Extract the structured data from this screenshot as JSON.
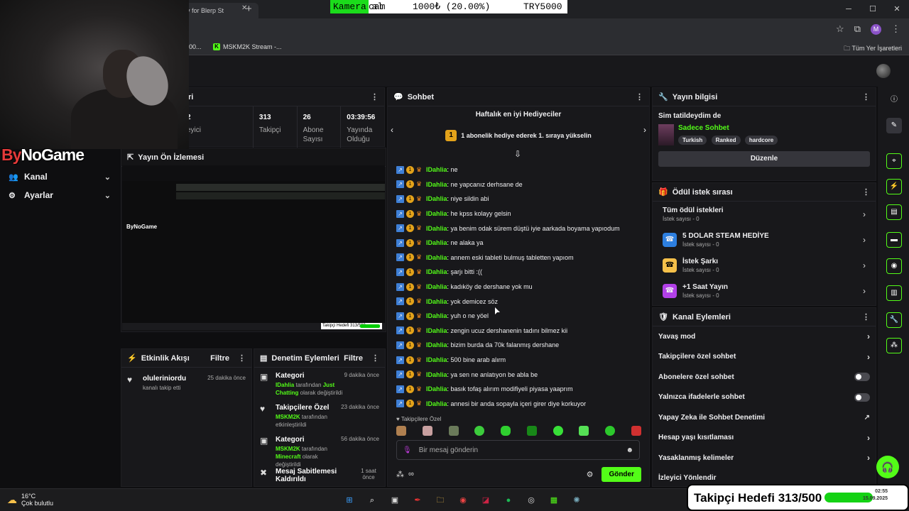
{
  "browser": {
    "tab_title": "ry for Blerp St",
    "bookmark_1": "00...",
    "bookmark_2": "MSKM2K Stream -...",
    "bookmarks_all": "Tüm Yer İşaretleri",
    "profile_letter": "M"
  },
  "ticker": {
    "camera": "Kamera al",
    "cam": "cam",
    "amount": "1000₺ (20.00%)",
    "total": "TRY5000"
  },
  "overlay": {
    "logo_by": "By",
    "logo_rest": "NoGame"
  },
  "sidebar": {
    "items": [
      {
        "label": "Kanal",
        "icon": "people-icon"
      },
      {
        "label": "Ayarlar",
        "icon": "gear-icon"
      }
    ]
  },
  "stats_panel": {
    "title": "ri",
    "stats": [
      {
        "value": "2",
        "label": "eyici"
      },
      {
        "value": "313",
        "label": "Takipçi"
      },
      {
        "value": "26",
        "label": "Abone Sayısı"
      },
      {
        "value": "03:39:56",
        "label": "Yayında Olduğu"
      }
    ]
  },
  "preview": {
    "title": "Yayın Ön İzlemesi",
    "goal": "Takipçi Hedefi 313/500"
  },
  "events": {
    "title": "Etkinlik Akışı",
    "filter": "Filtre",
    "items": [
      {
        "title": "oluleriniordu",
        "sub": "kanalı takip etti",
        "time": "25 dakika önce"
      }
    ]
  },
  "moderation": {
    "title": "Denetim Eylemleri",
    "filter": "Filtre",
    "items": [
      {
        "title": "Kategori",
        "actor": "IDahlia",
        "mid": "tarafından",
        "target": "Just Chatting",
        "end": "olarak değiştirildi",
        "time": "9 dakika önce"
      },
      {
        "title": "Takipçilere Özel",
        "actor": "MSKM2K",
        "mid": "tarafından etkinleştirildi",
        "target": "",
        "end": "",
        "time": "23 dakika önce"
      },
      {
        "title": "Kategori",
        "actor": "MSKM2K",
        "mid": "tarafından",
        "target": "Minecraft",
        "end": "olarak değiştirildi",
        "time": "56 dakika önce"
      },
      {
        "title": "Mesaj Sabitlemesi Kaldırıldı",
        "actor": "",
        "mid": "",
        "target": "",
        "end": "",
        "time": "1 saat önce"
      }
    ]
  },
  "chat": {
    "title": "Sohbet",
    "weekly_title": "Haftalık en iyi Hediyeciler",
    "weekly_rank": "1",
    "weekly_sub": "1 abonelik hediye ederek 1. sıraya yükselin",
    "messages": [
      {
        "user": "IDahlia",
        "text": ": ne"
      },
      {
        "user": "IDahlia",
        "text": ": ne yapcanız derhsane de"
      },
      {
        "user": "IDahlia",
        "text": ": niye sildin abi"
      },
      {
        "user": "IDahlia",
        "text": ": he kpss kolayy gelsin"
      },
      {
        "user": "IDahlia",
        "text": ": ya benim odak sürem düştü iyie aarkada boyama yapıodum"
      },
      {
        "user": "IDahlia",
        "text": ": ne alaka ya"
      },
      {
        "user": "IDahlia",
        "text": ": annem eski tableti bulmuş tabletten yapıom"
      },
      {
        "user": "IDahlia",
        "text": ": şarjı bitti :(("
      },
      {
        "user": "IDahlia",
        "text": ": kadıköy de dershane yok mu"
      },
      {
        "user": "IDahlia",
        "text": ": yok demicez söz"
      },
      {
        "user": "IDahlia",
        "text": ": yuh o ne yöel"
      },
      {
        "user": "IDahlia",
        "text": ": zengin ucuz dershanenin tadını bilmez kii"
      },
      {
        "user": "IDahlia",
        "text": ": bizim burda da 70k falanmış dershane"
      },
      {
        "user": "IDahlia",
        "text": ": 500 bine arab alırm"
      },
      {
        "user": "IDahlia",
        "text": ": ya sen ne anlatıyon be abla be"
      },
      {
        "user": "IDahlia",
        "text": ": basık tofaş alırım modifiyeli piyasa yaaprım"
      },
      {
        "user": "IDahlia",
        "text": ": annesi bir anda sopayla içeri girer diye korkuyor"
      }
    ],
    "followers_only": "Takipçilere Özel",
    "input_placeholder": "Bir mesaj gönderin",
    "send": "Gönder"
  },
  "stream_info": {
    "title": "Yayın bilgisi",
    "stream_title": "Sim tatildeydim de",
    "category": "Sadece Sohbet",
    "tags": [
      "Turkish",
      "Ranked",
      "hardcore"
    ],
    "edit": "Düzenle"
  },
  "rewards": {
    "title": "Ödül istek sırası",
    "all": {
      "title": "Tüm ödül istekleri",
      "sub": "İstek sayısı - 0"
    },
    "items": [
      {
        "title": "5 DOLAR STEAM HEDİYE",
        "sub": "İstek sayısı - 0",
        "color": "#2d7fe0"
      },
      {
        "title": "İstek Şarkı",
        "sub": "İstek sayısı - 0",
        "color": "#f5c04a"
      },
      {
        "title": "+1 Saat Yayın",
        "sub": "İstek sayısı - 0",
        "color": "#b240e8"
      }
    ]
  },
  "channel_actions": {
    "title": "Kanal Eylemleri",
    "items": [
      {
        "label": "Yavaş mod",
        "kind": "chevron"
      },
      {
        "label": "Takipçilere özel sohbet",
        "kind": "chevron"
      },
      {
        "label": "Abonelere özel sohbet",
        "kind": "toggle"
      },
      {
        "label": "Yalnızca ifadelerle sohbet",
        "kind": "toggle"
      },
      {
        "label": "Yapay Zeka ile Sohbet Denetimi",
        "kind": "external"
      },
      {
        "label": "Hesap yaşı kısıtlaması",
        "kind": "chevron"
      },
      {
        "label": "Yasaklanmış kelimeler",
        "kind": "chevron"
      },
      {
        "label": "İzleyici Yönlendir",
        "kind": "none"
      }
    ]
  },
  "taskbar": {
    "temp": "16°C",
    "weather": "Çok bulutlu",
    "time": "02:55",
    "date": "15.09.2025"
  },
  "goal_overlay": {
    "text": "Takipçi Hedefi 313/500"
  },
  "colors": {
    "accent": "#53fc18",
    "bg": "#0e0e10",
    "panel": "#18181b"
  }
}
